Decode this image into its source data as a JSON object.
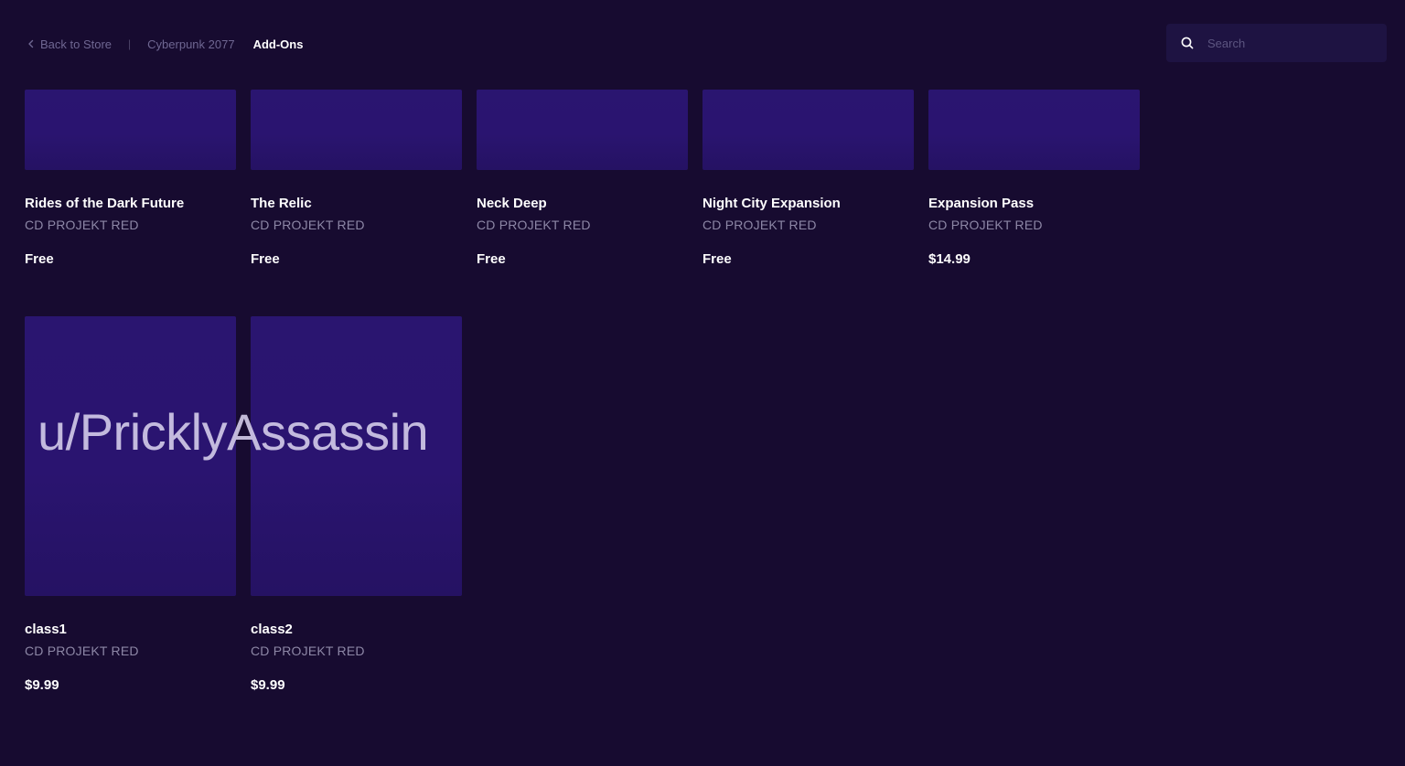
{
  "breadcrumb": {
    "back_label": "Back to Store",
    "separator": "|",
    "game": "Cyberpunk 2077",
    "current": "Add-Ons"
  },
  "search": {
    "placeholder": "Search",
    "value": ""
  },
  "addons": [
    {
      "title": "Rides of the Dark Future",
      "publisher": "CD PROJEKT RED",
      "price": "Free"
    },
    {
      "title": "The Relic",
      "publisher": "CD PROJEKT RED",
      "price": "Free"
    },
    {
      "title": "Neck Deep",
      "publisher": "CD PROJEKT RED",
      "price": "Free"
    },
    {
      "title": "Night City Expansion",
      "publisher": "CD PROJEKT RED",
      "price": "Free"
    },
    {
      "title": "Expansion Pass",
      "publisher": "CD PROJEKT RED",
      "price": "$14.99"
    },
    {
      "title": "class1",
      "publisher": "CD PROJEKT RED",
      "price": "$9.99"
    },
    {
      "title": "class2",
      "publisher": "CD PROJEKT RED",
      "price": "$9.99"
    }
  ],
  "watermark": "u/PricklyAssassin",
  "icons": {
    "back": "chevron-left-icon",
    "search": "search-icon"
  },
  "colors": {
    "background": "#170b30",
    "thumbnail": "#2a1570",
    "muted_text": "#8d87a6"
  }
}
